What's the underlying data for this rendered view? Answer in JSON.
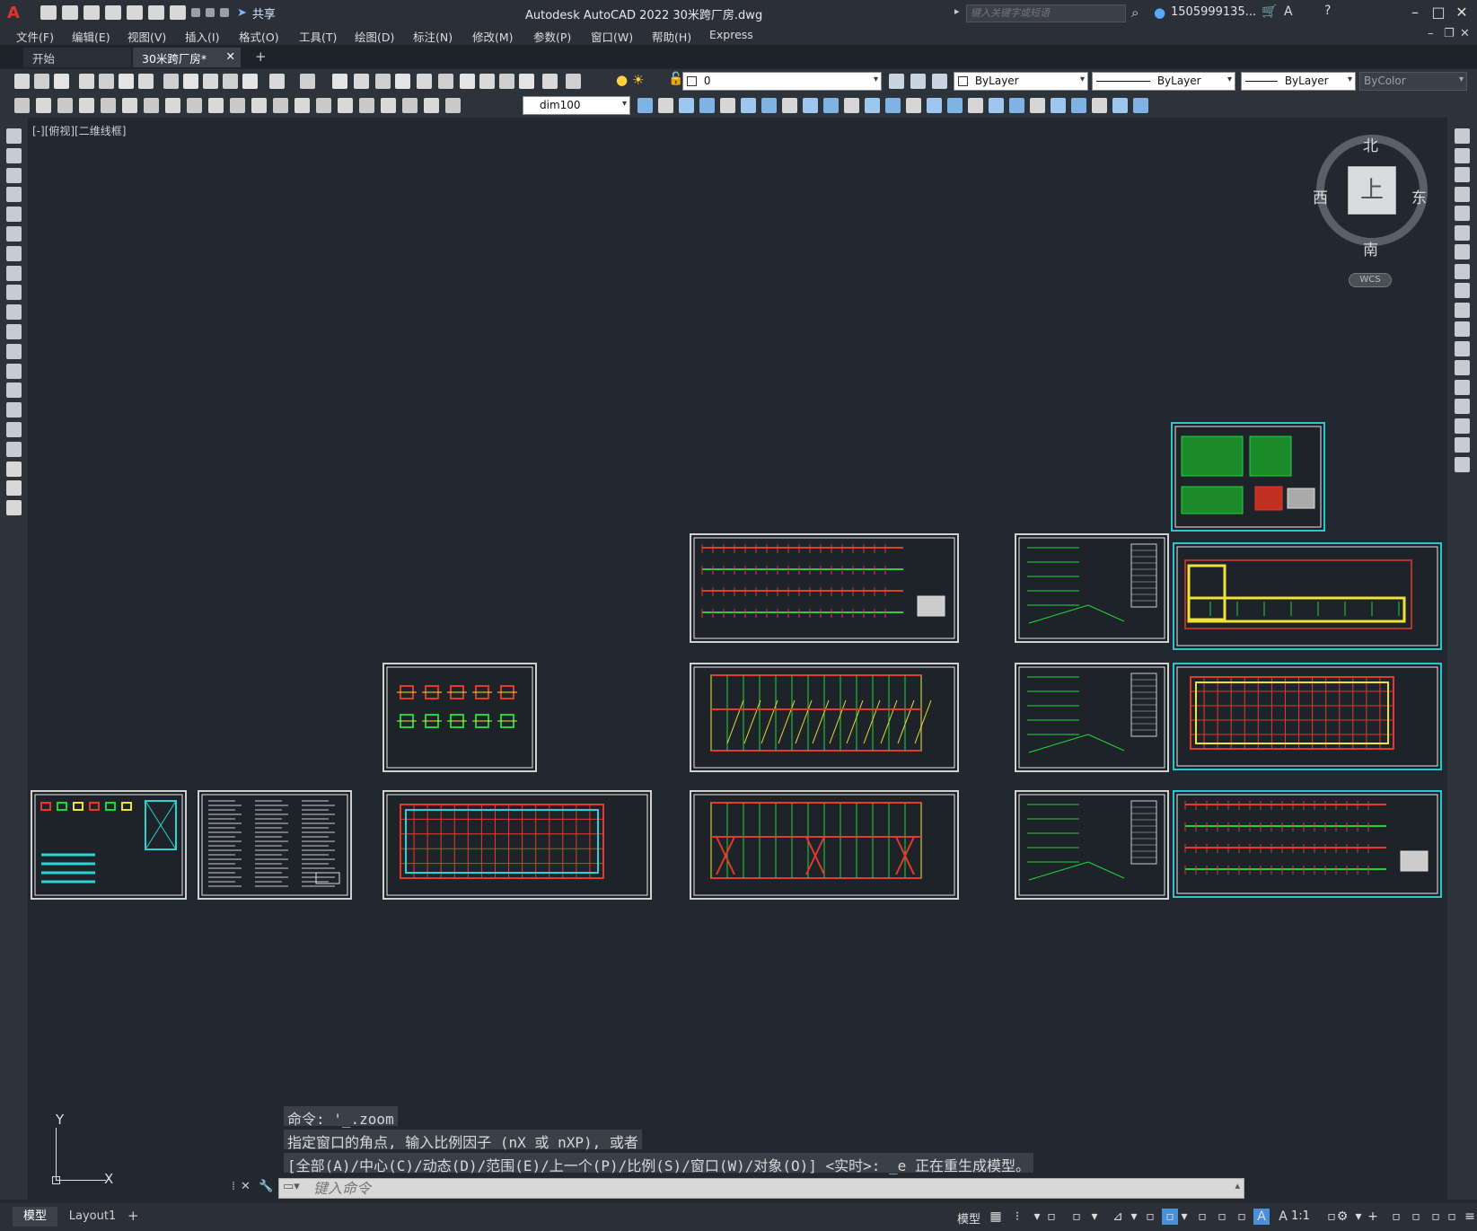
{
  "app": {
    "title": "Autodesk AutoCAD 2022    30米跨厂房.dwg",
    "logo": "A",
    "share_label": "共享",
    "search_placeholder": "键入关键字或短语",
    "user": "1505999135...",
    "window_controls": [
      "minimize-icon",
      "maximize-icon",
      "close-icon"
    ]
  },
  "menu": [
    "文件(F)",
    "编辑(E)",
    "视图(V)",
    "插入(I)",
    "格式(O)",
    "工具(T)",
    "绘图(D)",
    "标注(N)",
    "修改(M)",
    "参数(P)",
    "窗口(W)",
    "帮助(H)",
    "Express"
  ],
  "tabs": [
    {
      "label": "开始",
      "active": false
    },
    {
      "label": "30米跨厂房*",
      "active": true
    }
  ],
  "tab_add": "+",
  "layers": {
    "current_layer": "0",
    "color": "ByLayer",
    "linetype": "ByLayer",
    "lineweight": "ByLayer",
    "plotstyle": "ByColor",
    "dimstyle": "dim100"
  },
  "viewport_label": "[-][俯视][二维线框]",
  "viewcube": {
    "top": "上",
    "north": "北",
    "south": "南",
    "east": "东",
    "west": "西",
    "ucs": "WCS"
  },
  "ucs_axes": {
    "x": "X",
    "y": "Y"
  },
  "command": {
    "history": [
      "命令: '_.zoom",
      "指定窗口的角点, 输入比例因子 (nX 或 nXP), 或者",
      "[全部(A)/中心(C)/动态(D)/范围(E)/上一个(P)/比例(S)/窗口(W)/对象(O)] <实时>: _e 正在重生成模型。"
    ],
    "placeholder": "键入命令"
  },
  "layout_tabs": [
    {
      "label": "模型",
      "active": true
    },
    {
      "label": "Layout1",
      "active": false
    }
  ],
  "status": {
    "model_label": "模型",
    "scale": "1:1"
  },
  "colors": {
    "background": "#212830",
    "ui": "#2b3038",
    "selected_border": "#29c8d1",
    "red": "#e53a2b",
    "green": "#22d43a",
    "yellow": "#f0e23a",
    "cyan": "#2ad4d4"
  }
}
